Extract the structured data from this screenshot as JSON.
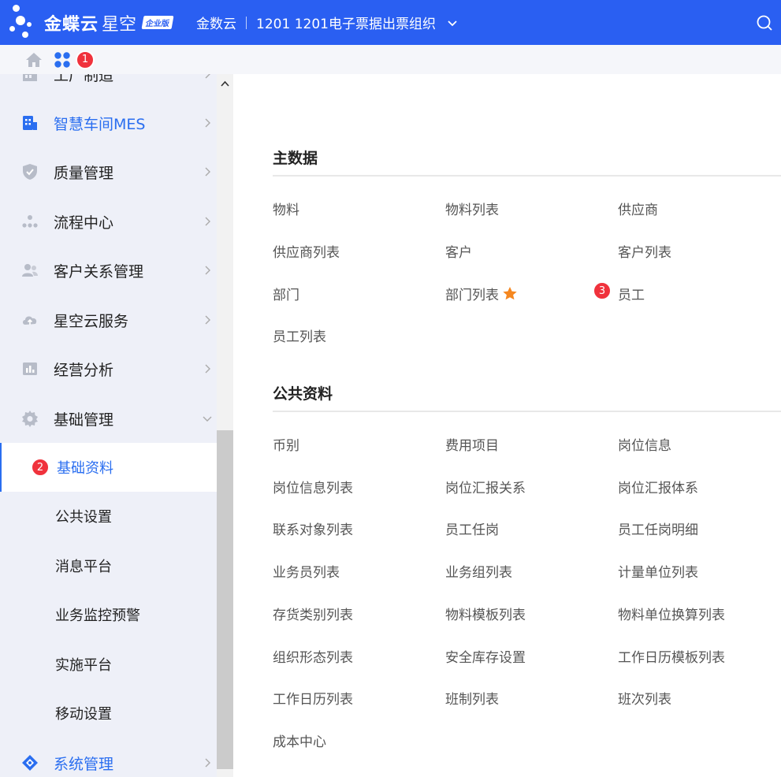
{
  "topbar": {
    "brand_bold": "金蝶云",
    "brand_light": "星空",
    "edition": "企业版",
    "cloud_name": "金数云",
    "org_name": "1201 1201电子票据出票组织"
  },
  "subbar": {
    "badge": "1"
  },
  "sidebar": {
    "items": [
      {
        "label": "工厂制造",
        "icon": "factory-icon"
      },
      {
        "label": "智慧车间MES",
        "icon": "building-icon"
      },
      {
        "label": "质量管理",
        "icon": "shield-check-icon"
      },
      {
        "label": "流程中心",
        "icon": "flow-dots-icon"
      },
      {
        "label": "客户关系管理",
        "icon": "people-icon"
      },
      {
        "label": "星空云服务",
        "icon": "cloud-icon"
      },
      {
        "label": "经营分析",
        "icon": "chart-icon"
      },
      {
        "label": "基础管理",
        "icon": "gear-icon"
      }
    ],
    "subitems": [
      {
        "label": "基础资料",
        "badge": "2"
      },
      {
        "label": "公共设置"
      },
      {
        "label": "消息平台"
      },
      {
        "label": "业务监控预警"
      },
      {
        "label": "实施平台"
      },
      {
        "label": "移动设置"
      }
    ],
    "bottom_item": {
      "label": "系统管理",
      "icon": "system-icon"
    }
  },
  "main": {
    "sections": [
      {
        "title": "主数据",
        "links": [
          "物料",
          "物料列表",
          "供应商",
          "供应商列表",
          "客户",
          "客户列表",
          "部门",
          "部门列表",
          "员工",
          "员工列表"
        ]
      },
      {
        "title": "公共资料",
        "links": [
          "币别",
          "费用项目",
          "岗位信息",
          "岗位信息列表",
          "岗位汇报关系",
          "岗位汇报体系",
          "联系对象列表",
          "员工任岗",
          "员工任岗明细",
          "业务员列表",
          "业务组列表",
          "计量单位列表",
          "存货类别列表",
          "物料模板列表",
          "物料单位换算列表",
          "组织形态列表",
          "安全库存设置",
          "工作日历模板列表",
          "工作日历列表",
          "班制列表",
          "班次列表",
          "成本中心"
        ]
      }
    ],
    "employee_badge": "3"
  },
  "colors": {
    "brand": "#2a5ff2",
    "accent": "#2a6ef0",
    "badge": "#f0323c",
    "star": "#f5871f"
  }
}
